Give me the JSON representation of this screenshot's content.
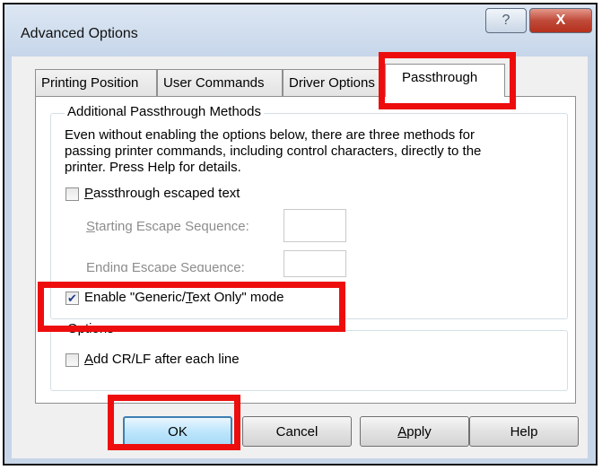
{
  "window": {
    "title": "Advanced Options",
    "help_glyph": "?",
    "close_glyph": "X"
  },
  "tabs": [
    {
      "label": "Printing Position",
      "active": false
    },
    {
      "label": "User Commands",
      "active": false
    },
    {
      "label": "Driver Options",
      "active": false
    },
    {
      "label": "Passthrough",
      "active": true
    }
  ],
  "passthrough_group": {
    "legend": "Additional Passthrough Methods",
    "description_lines": [
      "Even without enabling the options below, there are three methods for",
      "passing printer commands, including control characters, directly to the",
      "printer.  Press Help for details."
    ],
    "escaped_text": {
      "label_key": "P",
      "label_rest": "assthrough escaped text",
      "checked": false
    },
    "starting_escape": {
      "label_key": "S",
      "label_rest": "tarting Escape Sequence:",
      "value": ""
    },
    "ending_escape": {
      "label_key": "E",
      "label_rest": "nding Escape Sequence:",
      "value": ""
    },
    "generic_mode": {
      "label_before": "Enable \"Generic/",
      "label_key": "T",
      "label_after": "ext Only\" mode",
      "checked": true
    }
  },
  "options_group": {
    "legend": "Options",
    "crlf": {
      "label_key": "A",
      "label_rest": "dd CR/LF after each line",
      "checked": false
    }
  },
  "buttons": {
    "ok": "OK",
    "cancel": "Cancel",
    "apply_key": "A",
    "apply_rest": "pply",
    "help": "Help"
  },
  "highlight_color": "#ee0d0d"
}
